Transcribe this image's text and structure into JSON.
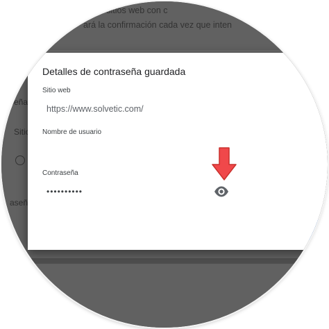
{
  "background": {
    "line1": "te en sitios web con c",
    "line2": "ará la confirmación cada vez que inten",
    "side_items": [
      "seña",
      "Sitio",
      "aseña"
    ]
  },
  "dialog": {
    "title": "Detalles de contraseña guardada",
    "site_label": "Sitio web",
    "site_value": "https://www.solvetic.com/",
    "username_label": "Nombre de usuario",
    "username_value": "",
    "password_label": "Contraseña",
    "password_value": "••••••••••",
    "show_password_icon": "eye-icon"
  },
  "annotation": {
    "arrow_icon": "red-down-arrow-icon",
    "arrow_color": "#f0484a"
  },
  "colors": {
    "overlay": "#616161",
    "accent": "#1a73e8"
  }
}
